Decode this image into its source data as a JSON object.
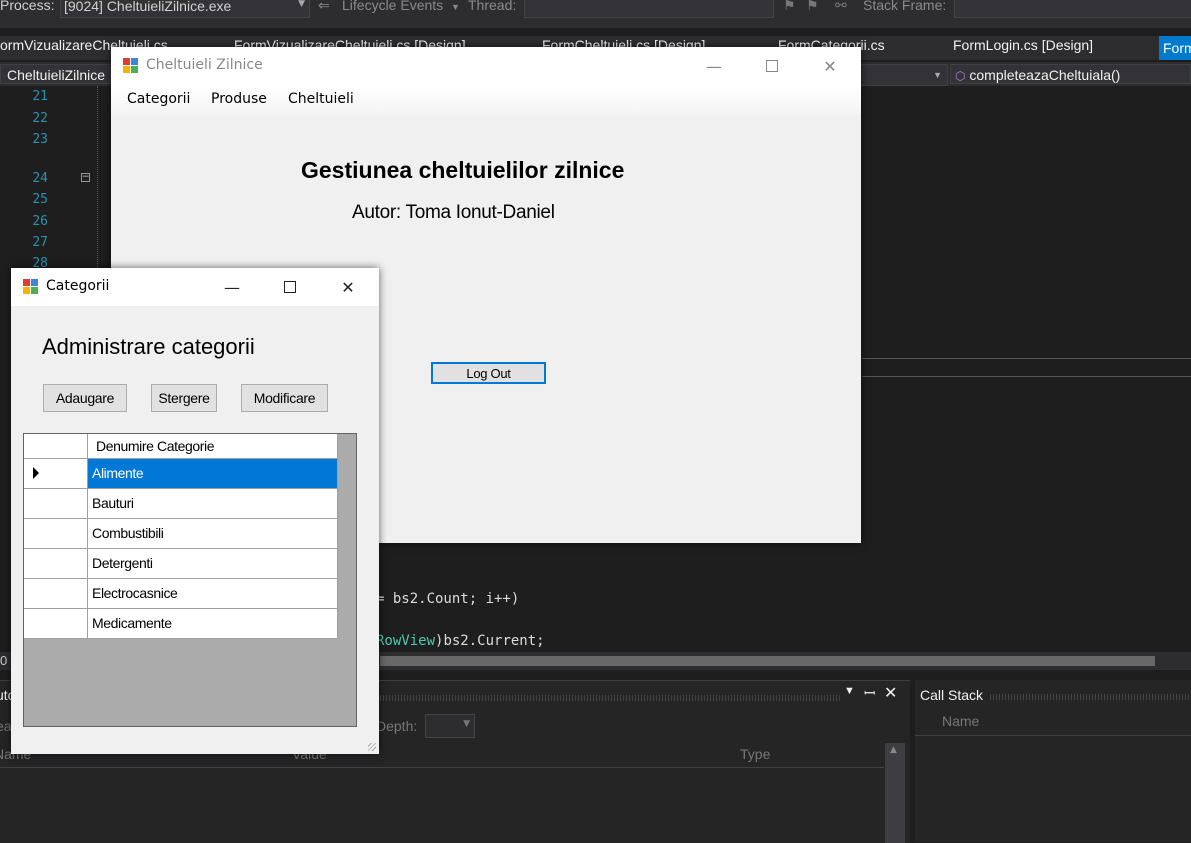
{
  "ide": {
    "process_label": "Process:",
    "process_value": "[9024] CheltuieliZilnice.exe",
    "lifecycle_label": "Lifecycle Events",
    "thread_label": "Thread:",
    "stackframe_label": "Stack Frame:",
    "tabs": [
      "ormVizualizareCheltuieli.cs",
      "FormVizualizareCheltuieli.cs [Design]",
      "FormCheltuieli.cs [Design]",
      "FormCategorii.cs",
      "FormLogin.cs [Design]",
      "Form"
    ],
    "nav_left": "CheltuieliZilnice",
    "nav_right": "completeazaCheltuiala()",
    "line_numbers": [
      "21",
      "22",
      "23",
      "24",
      "25",
      "26",
      "27",
      "28"
    ],
    "code_line1_prefix": "= ",
    "code_line1": "bs2.Count; i++)",
    "code_line2_kw": "RowView",
    "code_line2": ")bs2.Current;",
    "code_line3": ");",
    "hscroll_left": "0",
    "bottom_panel": {
      "title_fragment": "uto",
      "search_fragment": "ea",
      "depth_label": "Depth:",
      "col_name": "Name",
      "col_value": "Value",
      "col_type": "Type"
    },
    "callstack": {
      "title": "Call Stack",
      "col_name": "Name"
    }
  },
  "main_form": {
    "title": "Cheltuieli Zilnice",
    "menu": [
      "Categorii",
      "Produse",
      "Cheltuieli"
    ],
    "heading": "Gestiunea cheltuielilor zilnice",
    "author": "Autor: Toma Ionut-Daniel",
    "logout": "Log Out"
  },
  "categories_form": {
    "title": "Categorii",
    "heading": "Administrare categorii",
    "buttons": [
      "Adaugare",
      "Stergere",
      "Modificare"
    ],
    "grid_header": "Denumire Categorie",
    "rows": [
      "Alimente",
      "Bauturi",
      "Combustibili",
      "Detergenti",
      "Electrocasnice",
      "Medicamente"
    ],
    "selected_index": 0
  },
  "colors": {
    "selection": "#0078d7",
    "ide_accent": "#007acc",
    "form_bg": "#f0f0f0"
  }
}
